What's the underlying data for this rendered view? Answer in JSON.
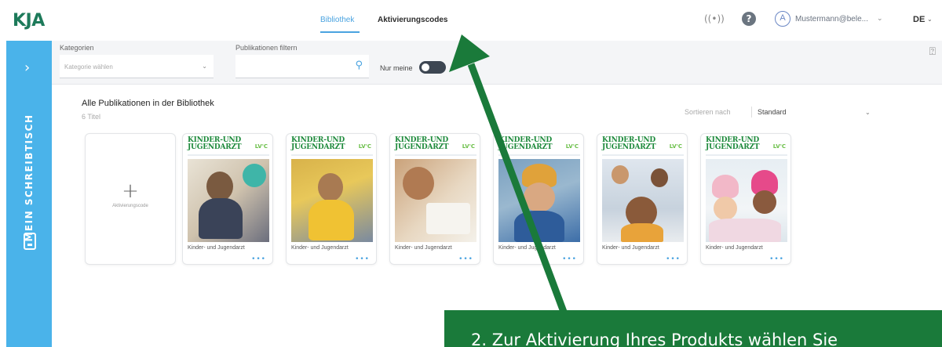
{
  "header": {
    "logo": "KJA",
    "tabs": [
      {
        "label": "Bibliothek",
        "active": true
      },
      {
        "label": "Aktivierungscodes",
        "active": false
      }
    ],
    "user_name": "Mustermann@bele...",
    "user_initial": "A",
    "language": "DE",
    "icons": [
      "signal-icon",
      "help-icon",
      "avatar-icon",
      "chevron-down-icon"
    ]
  },
  "sidebar": {
    "label": "MEIN SCHREIBTISCH",
    "icons": [
      "chevron-right-icon",
      "book-icon"
    ],
    "color": "#4ab3ea"
  },
  "filters": {
    "category_label": "Kategorien",
    "category_placeholder": "Kategorie wählen",
    "search_label": "Publikationen filtern",
    "search_value": "",
    "toggle_label": "Nur meine"
  },
  "library": {
    "title": "Alle Publikationen in der Bibliothek",
    "count": "6 Titel",
    "sort_label": "Sortieren nach",
    "sort_value": "Standard",
    "add_label": "Aktivierungscode",
    "publications": [
      {
        "cover_title_1": "KINDER-UND",
        "cover_title_2": "JUGENDARZT",
        "badge": "LV'C",
        "label": "Kinder- und Jugendarzt"
      },
      {
        "cover_title_1": "KINDER-UND",
        "cover_title_2": "JUGENDARZT",
        "badge": "LV'C",
        "label": "Kinder- und Jugendarzt"
      },
      {
        "cover_title_1": "KINDER-UND",
        "cover_title_2": "JUGENDARZT",
        "badge": "LV'C",
        "label": "Kinder- und Jugendarzt"
      },
      {
        "cover_title_1": "KINDER-UND",
        "cover_title_2": "JUGENDARZT",
        "badge": "LV'C",
        "label": "Kinder- und Jugendarzt"
      },
      {
        "cover_title_1": "KINDER-UND",
        "cover_title_2": "JUGENDARZT",
        "badge": "LV'C",
        "label": "Kinder- und Jugendarzt"
      },
      {
        "cover_title_1": "KINDER-UND",
        "cover_title_2": "JUGENDARZT",
        "badge": "LV'C",
        "label": "Kinder- und Jugendarzt"
      }
    ]
  },
  "annotation": {
    "text": "2. Zur Aktivierung Ihres Produkts wählen Sie",
    "color": "#1a7a3a"
  }
}
